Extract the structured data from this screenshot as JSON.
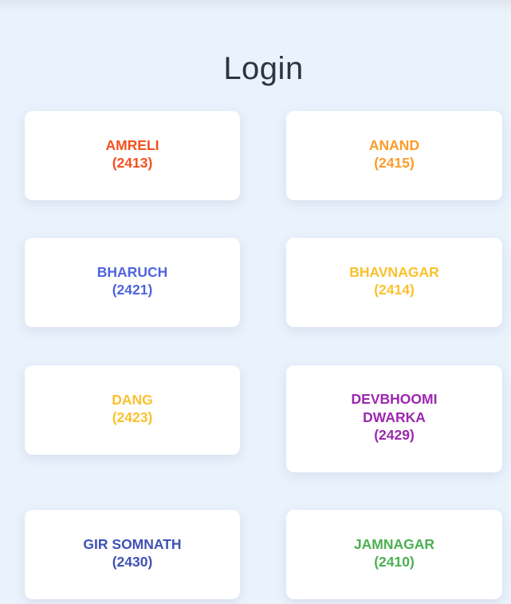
{
  "page": {
    "title": "Login"
  },
  "districts": [
    {
      "name": "AMRELI",
      "code": "(2413)",
      "color": "#f4511e"
    },
    {
      "name": "ANAND",
      "code": "(2415)",
      "color": "#fb9c2a"
    },
    {
      "name": "BHARUCH",
      "code": "(2421)",
      "color": "#4f63e0"
    },
    {
      "name": "BHAVNAGAR",
      "code": "(2414)",
      "color": "#fbc02d"
    },
    {
      "name": "DANG",
      "code": "(2423)",
      "color": "#fbc02d"
    },
    {
      "name_line1": "DEVBHOOMI",
      "name_line2": "DWARKA",
      "code": "(2429)",
      "color": "#9c27b0"
    },
    {
      "name": "GIR SOMNATH",
      "code": "(2430)",
      "color": "#3f51b5"
    },
    {
      "name": "JAMNAGAR",
      "code": "(2410)",
      "color": "#4caf50"
    }
  ]
}
